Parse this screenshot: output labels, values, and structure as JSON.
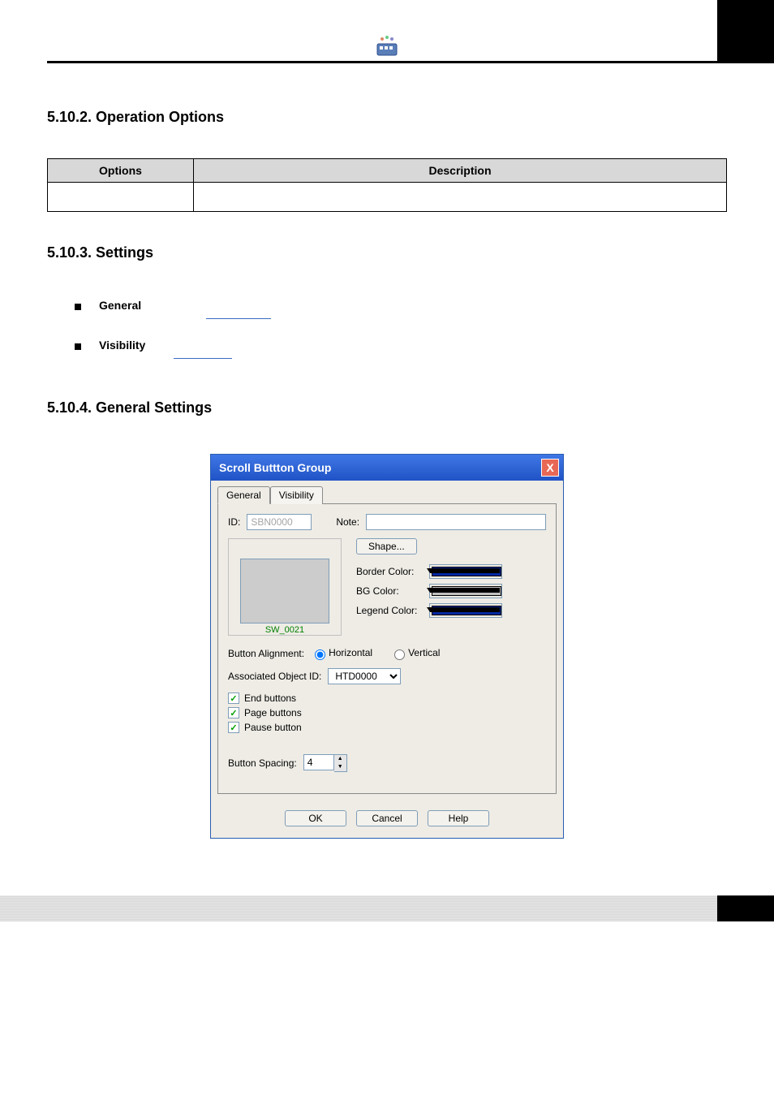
{
  "header": {
    "icon_name": "app-icon"
  },
  "sections": {
    "s5102": {
      "title": "5.10.2. Operation Options",
      "table": {
        "head1": "Options",
        "head2": "Description"
      }
    },
    "s5103": {
      "title": "5.10.3. Settings",
      "bullets": [
        {
          "label": "General"
        },
        {
          "label": "Visibility"
        }
      ]
    },
    "s5104": {
      "title": "5.10.4. General Settings"
    }
  },
  "dialog": {
    "title": "Scroll Buttton Group",
    "close_label": "X",
    "tabs": {
      "general": "General",
      "visibility": "Visibility"
    },
    "form": {
      "id_label": "ID:",
      "id_value": "SBN0000",
      "note_label": "Note:",
      "shape_button": "Shape...",
      "shape_name": "SW_0021",
      "border_color_label": "Border Color:",
      "border_color": "#0028a0",
      "bg_color_label": "BG Color:",
      "bg_color": "#c0c0c0",
      "legend_color_label": "Legend Color:",
      "legend_color": "#0028a0",
      "button_alignment_label": "Button Alignment:",
      "alignment_horizontal": "Horizontal",
      "alignment_vertical": "Vertical",
      "alignment_selected": "horizontal",
      "associated_obj_label": "Associated Object ID:",
      "associated_obj_value": "HTD0000",
      "end_buttons_label": "End buttons",
      "page_buttons_label": "Page buttons",
      "pause_button_label": "Pause button",
      "end_buttons_checked": true,
      "page_buttons_checked": true,
      "pause_button_checked": true,
      "button_spacing_label": "Button Spacing:",
      "button_spacing_value": "4"
    },
    "buttons": {
      "ok": "OK",
      "cancel": "Cancel",
      "help": "Help"
    }
  }
}
